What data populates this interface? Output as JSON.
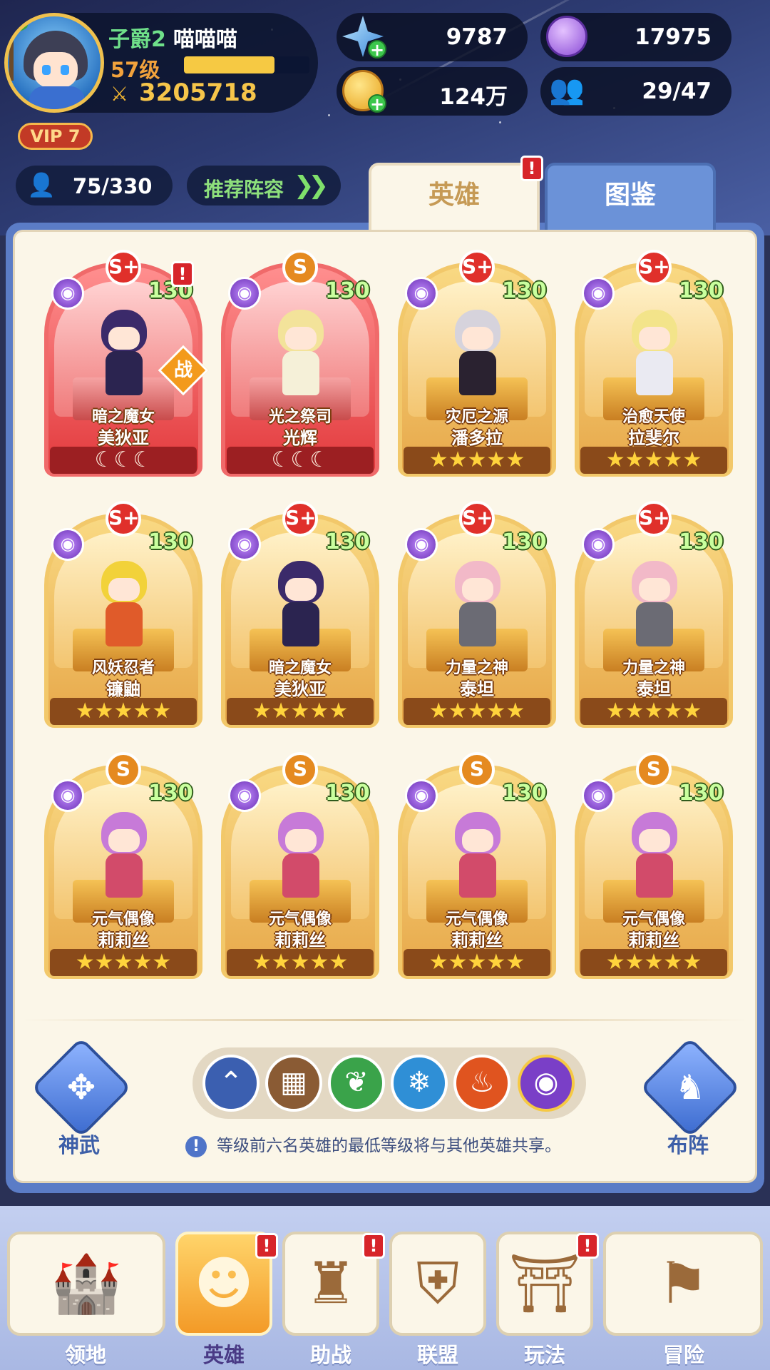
{
  "player": {
    "title": "子爵2",
    "name": "喵喵喵",
    "level": "57级",
    "exp_fraction": 0.72,
    "power": "3205718",
    "vip": "VIP 7"
  },
  "resources": {
    "gems": "9787",
    "orbs": "17975",
    "gold": "124万",
    "friends": "29/47"
  },
  "toolbar": {
    "hero_count": "75/330",
    "recommend_label": "推荐阵容"
  },
  "tabs": {
    "heroes": "英雄",
    "codex": "图鉴",
    "alert": "!"
  },
  "heroes": [
    {
      "grade": "S+",
      "level": "130",
      "title": "暗之魔女",
      "name": "美狄亚",
      "stars": "☾☾☾",
      "red": true
    },
    {
      "grade": "S",
      "level": "130",
      "title": "光之祭司",
      "name": "光辉",
      "stars": "☾☾☾",
      "red": true
    },
    {
      "grade": "S+",
      "level": "130",
      "title": "灾厄之源",
      "name": "潘多拉",
      "stars": "★★★★★",
      "red": false
    },
    {
      "grade": "S+",
      "level": "130",
      "title": "治愈天使",
      "name": "拉斐尔",
      "stars": "★★★★★",
      "red": false
    },
    {
      "grade": "S+",
      "level": "130",
      "title": "风妖忍者",
      "name": "镰鼬",
      "stars": "★★★★★",
      "red": false
    },
    {
      "grade": "S+",
      "level": "130",
      "title": "暗之魔女",
      "name": "美狄亚",
      "stars": "★★★★★",
      "red": false
    },
    {
      "grade": "S+",
      "level": "130",
      "title": "力量之神",
      "name": "泰坦",
      "stars": "★★★★★",
      "red": false
    },
    {
      "grade": "S+",
      "level": "130",
      "title": "力量之神",
      "name": "泰坦",
      "stars": "★★★★★",
      "red": false
    },
    {
      "grade": "S",
      "level": "130",
      "title": "元气偶像",
      "name": "莉莉丝",
      "stars": "★★★★★",
      "red": false
    },
    {
      "grade": "S",
      "level": "130",
      "title": "元气偶像",
      "name": "莉莉丝",
      "stars": "★★★★★",
      "red": false
    },
    {
      "grade": "S",
      "level": "130",
      "title": "元气偶像",
      "name": "莉莉丝",
      "stars": "★★★★★",
      "red": false
    },
    {
      "grade": "S",
      "level": "130",
      "title": "元气偶像",
      "name": "莉莉丝",
      "stars": "★★★★★",
      "red": false
    }
  ],
  "war_badge": "战",
  "bottom": {
    "divine_weapon": "神武",
    "formation": "布阵",
    "notice": "等级前六名英雄的最低等级将与其他英雄共享。"
  },
  "nav": {
    "territory": "领地",
    "heroes": "英雄",
    "assist": "助战",
    "alliance": "联盟",
    "gameplay": "玩法",
    "adventure": "冒险"
  },
  "icons": {
    "gem": "gem-icon",
    "orb": "orb-icon",
    "gold": "coin-icon",
    "friends": "people-icon",
    "faction": "eye-faction-icon"
  },
  "colors": {
    "panel_border": "#5b7cc6",
    "panel_bg": "#fbf6e8",
    "gold_frame": "#f2c86a",
    "red_frame": "#f06a6a",
    "nav_active": "#f39a27"
  }
}
